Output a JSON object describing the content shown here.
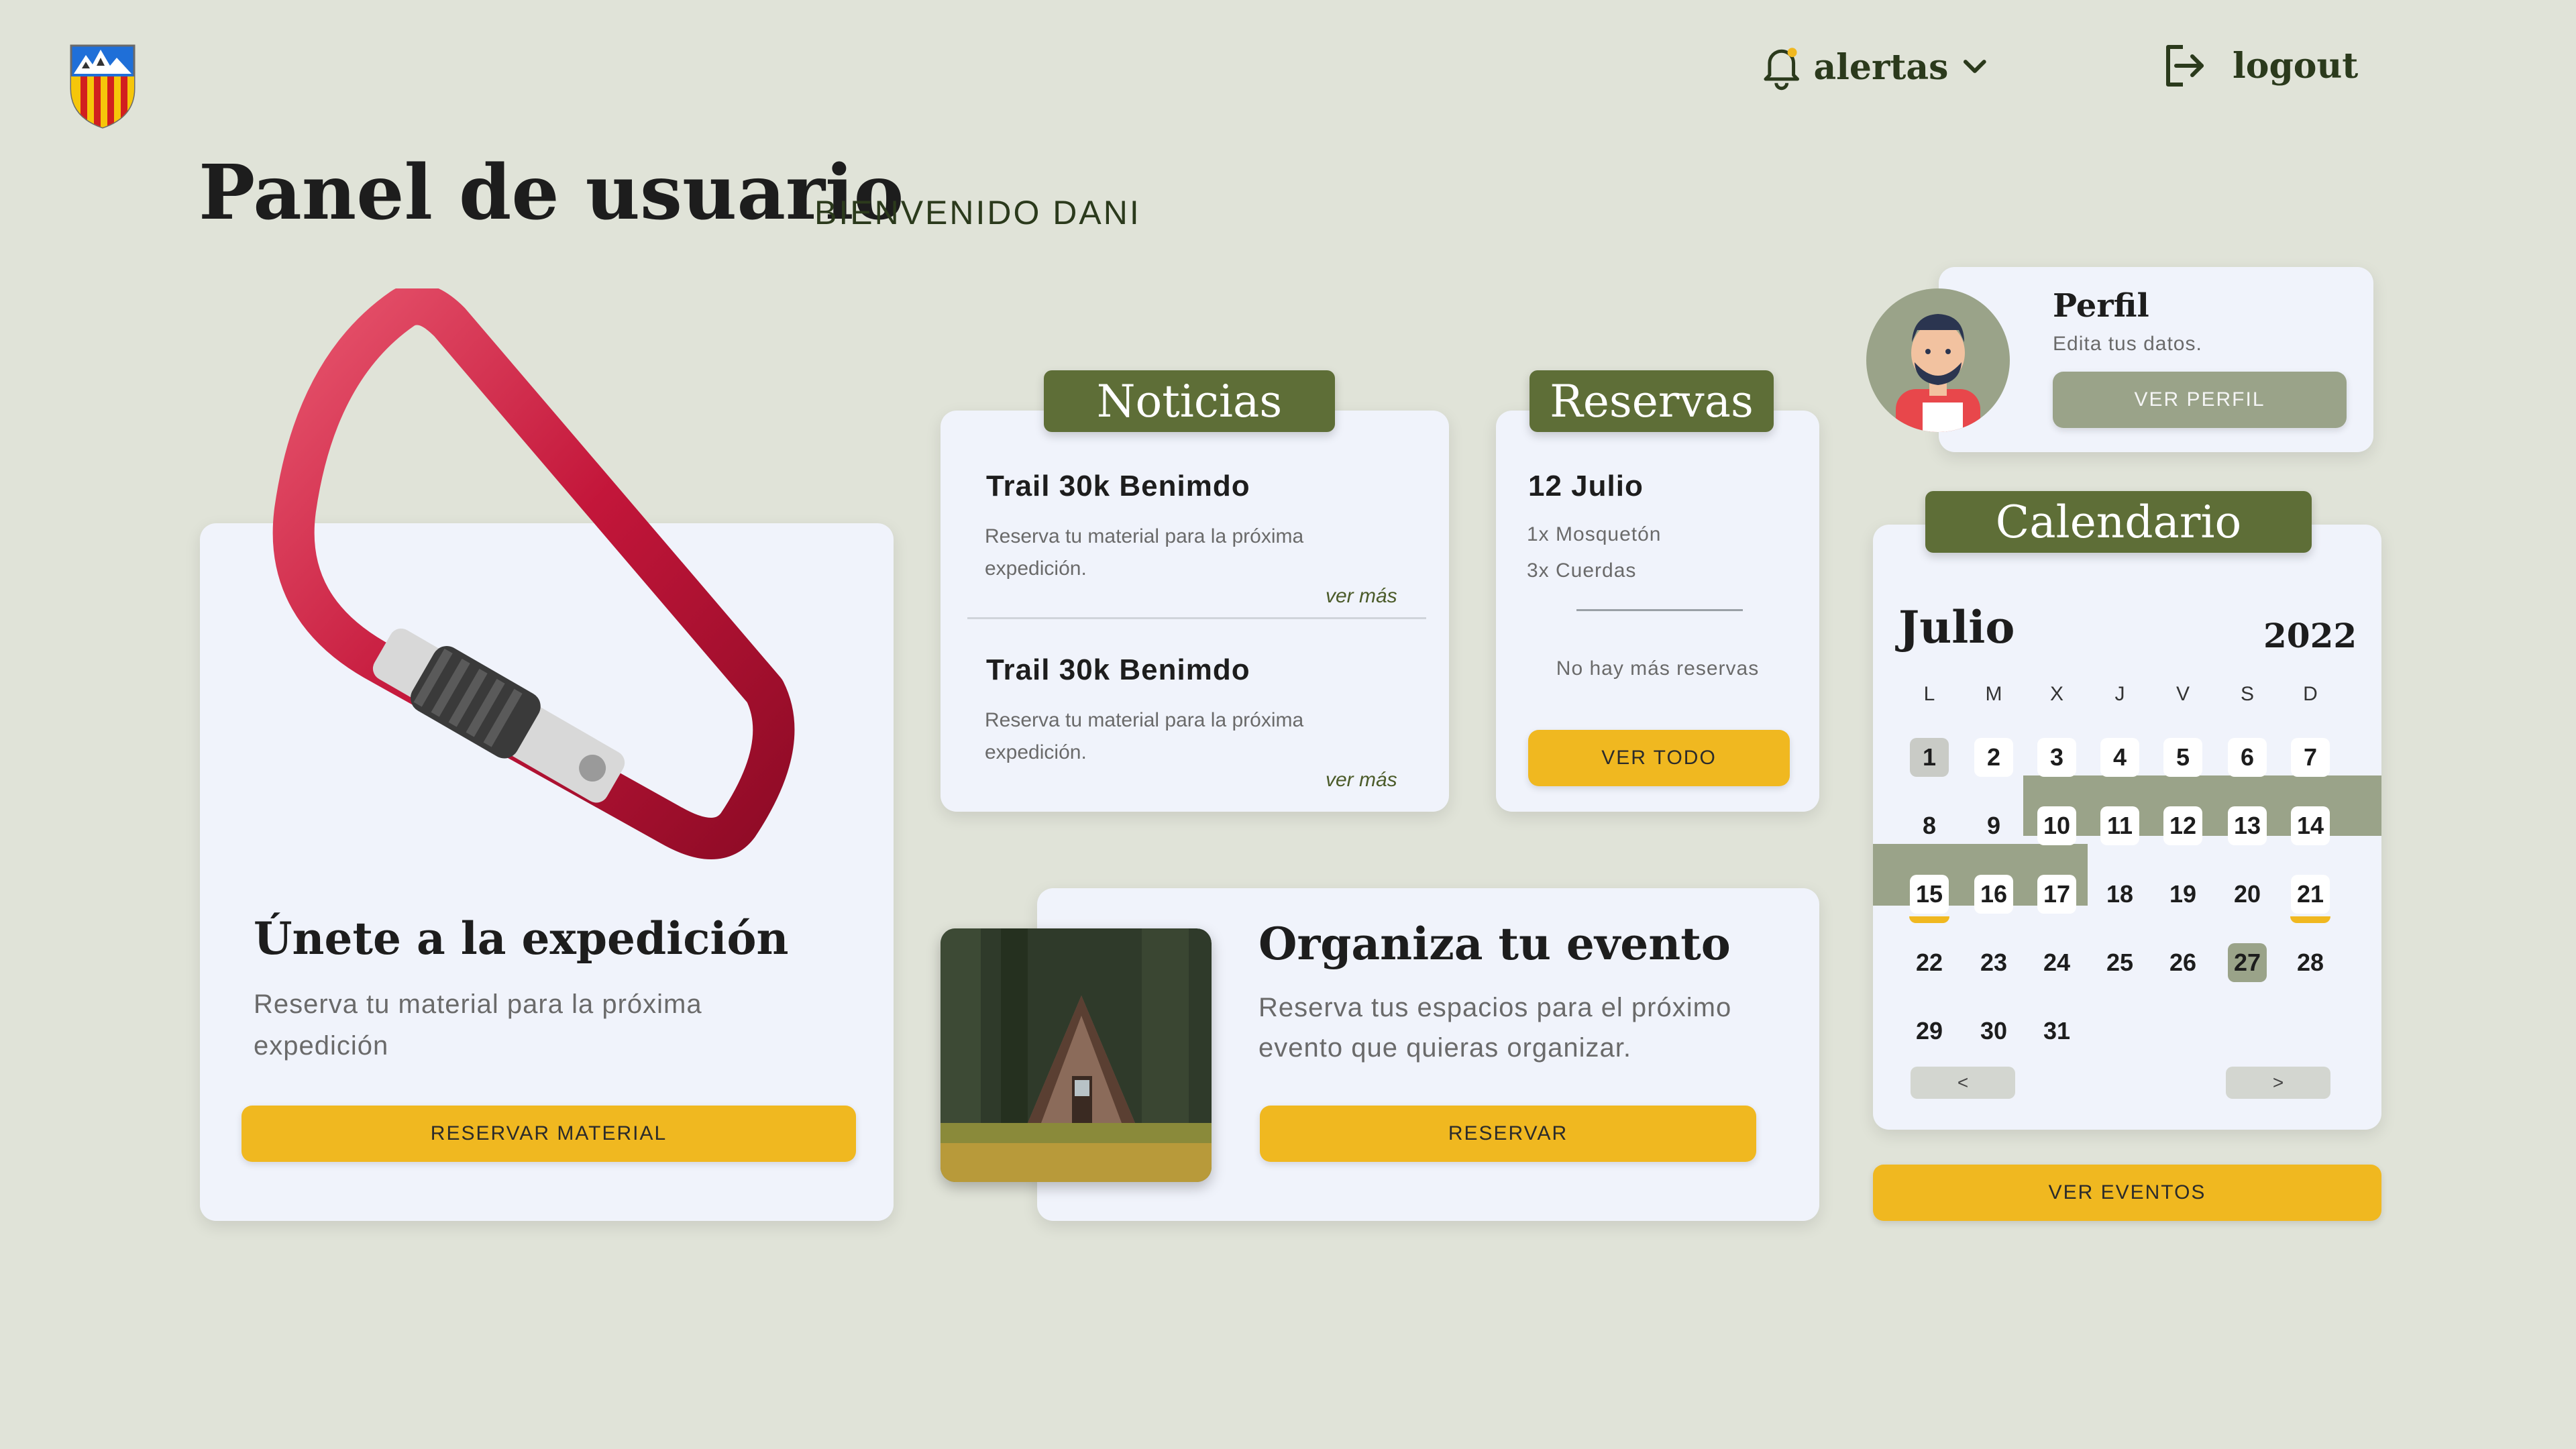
{
  "header": {
    "alerts_label": "alertas",
    "logout_label": "logout"
  },
  "page": {
    "title": "Panel de usuario",
    "welcome": "BIENVENIDO DANI"
  },
  "expedition": {
    "title": "Únete a la expedición",
    "description": "Reserva tu material para la próxima expedición",
    "button": "RESERVAR MATERIAL"
  },
  "news": {
    "tab": "Noticias",
    "items": [
      {
        "title": "Trail 30k Benimdo",
        "desc": "Reserva tu material para la próxima expedición.",
        "more": "ver más"
      },
      {
        "title": "Trail 30k Benimdo",
        "desc": "Reserva tu material para la próxima expedición.",
        "more": "ver más"
      }
    ]
  },
  "reservations": {
    "tab": "Reservas",
    "date": "12 Julio",
    "items": [
      "1x Mosquetón",
      "3x Cuerdas"
    ],
    "empty": "No hay más reservas",
    "button": "VER TODO"
  },
  "event": {
    "title": "Organiza tu evento",
    "description": "Reserva tus espacios para el próximo evento que quieras organizar.",
    "button": "RESERVAR"
  },
  "profile": {
    "title": "Perfil",
    "subtitle": "Edita tus datos.",
    "button": "VER PERFIL"
  },
  "calendar": {
    "tab": "Calendario",
    "month": "Julio",
    "year": "2022",
    "weekdays": [
      "L",
      "M",
      "X",
      "J",
      "V",
      "S",
      "D"
    ],
    "prev": "<",
    "next": ">",
    "button": "VER EVENTOS",
    "selected_day": 1,
    "today": 27,
    "range_start": 10,
    "range_end": 17,
    "marked_days": [
      15,
      21
    ]
  },
  "colors": {
    "background": "#e0e3d8",
    "card": "#f0f3fb",
    "accent_yellow": "#f0b820",
    "accent_green": "#5e6e37",
    "muted_green": "#9aa389"
  }
}
